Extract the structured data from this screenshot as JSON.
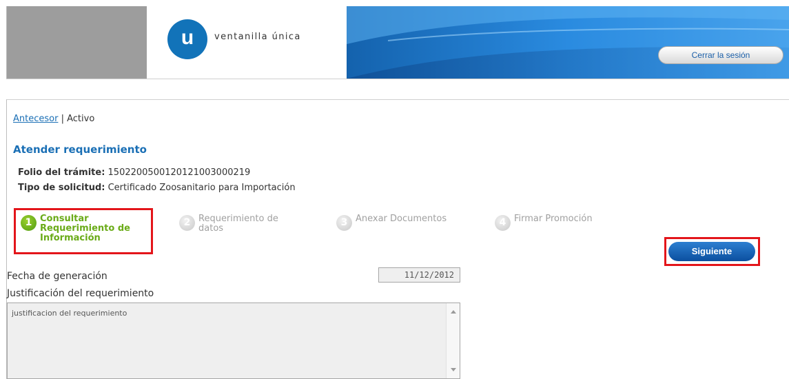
{
  "header": {
    "logo_letter": "u",
    "logo_text": "ventanilla única",
    "logout_label": "Cerrar la sesión",
    "colors": {
      "gray": "#9d9d9d",
      "blue": "#1b73c4",
      "logo": "#1273b9"
    }
  },
  "breadcrumb": {
    "link": "Antecesor",
    "separator": "|",
    "current": "Activo"
  },
  "title": "Atender requerimiento",
  "info": {
    "folio_label": "Folio del trámite:",
    "folio_value": "150220050012012100300021​9",
    "tipo_label": "Tipo de solicitud:",
    "tipo_value": "Certificado Zoosanitario para Importación"
  },
  "steps": [
    {
      "num": "1",
      "label": "Consultar Requerimiento de Información",
      "active": true
    },
    {
      "num": "2",
      "label": "Requerimiento de datos",
      "active": false
    },
    {
      "num": "3",
      "label": "Anexar Documentos",
      "active": false
    },
    {
      "num": "4",
      "label": "Firmar Promoción",
      "active": false
    }
  ],
  "next_label": "Siguiente",
  "form": {
    "fecha_label": "Fecha de generación",
    "fecha_value": "11/12/2012",
    "just_label": "Justificación del requerimiento",
    "just_value": "justificacion del requerimiento"
  },
  "colors": {
    "accent": "#1a6fb5",
    "active_step": "#6aab18",
    "highlight": "#e3151a"
  }
}
